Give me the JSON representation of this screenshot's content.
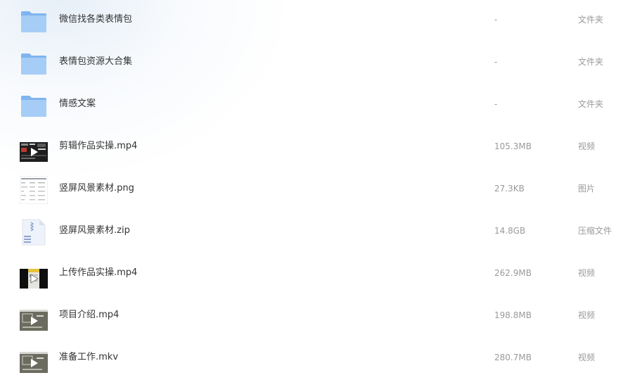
{
  "files": [
    {
      "name": "微信找各类表情包",
      "size": "-",
      "type": "文件夹",
      "icon": "folder-icon"
    },
    {
      "name": "表情包资源大合集",
      "size": "-",
      "type": "文件夹",
      "icon": "folder-icon"
    },
    {
      "name": "情感文案",
      "size": "-",
      "type": "文件夹",
      "icon": "folder-icon"
    },
    {
      "name": "剪辑作品实操.mp4",
      "size": "105.3MB",
      "type": "视频",
      "icon": "video-thumbnail-icon"
    },
    {
      "name": "竖屏风景素材.png",
      "size": "27.3KB",
      "type": "图片",
      "icon": "image-thumbnail-icon"
    },
    {
      "name": "竖屏风景素材.zip",
      "size": "14.8GB",
      "type": "压缩文件",
      "icon": "zip-file-icon"
    },
    {
      "name": "上传作品实操.mp4",
      "size": "262.9MB",
      "type": "视频",
      "icon": "video-thumbnail-icon"
    },
    {
      "name": "项目介绍.mp4",
      "size": "198.8MB",
      "type": "视频",
      "icon": "video-thumbnail-icon"
    },
    {
      "name": "准备工作.mkv",
      "size": "280.7MB",
      "type": "视频",
      "icon": "video-thumbnail-icon"
    }
  ],
  "colors": {
    "folder_back": "#7fb4ef",
    "folder_front": "#a6cdf6",
    "text": "#333333",
    "muted": "#9a9a9a",
    "video_bg": "#6b6b5f"
  }
}
